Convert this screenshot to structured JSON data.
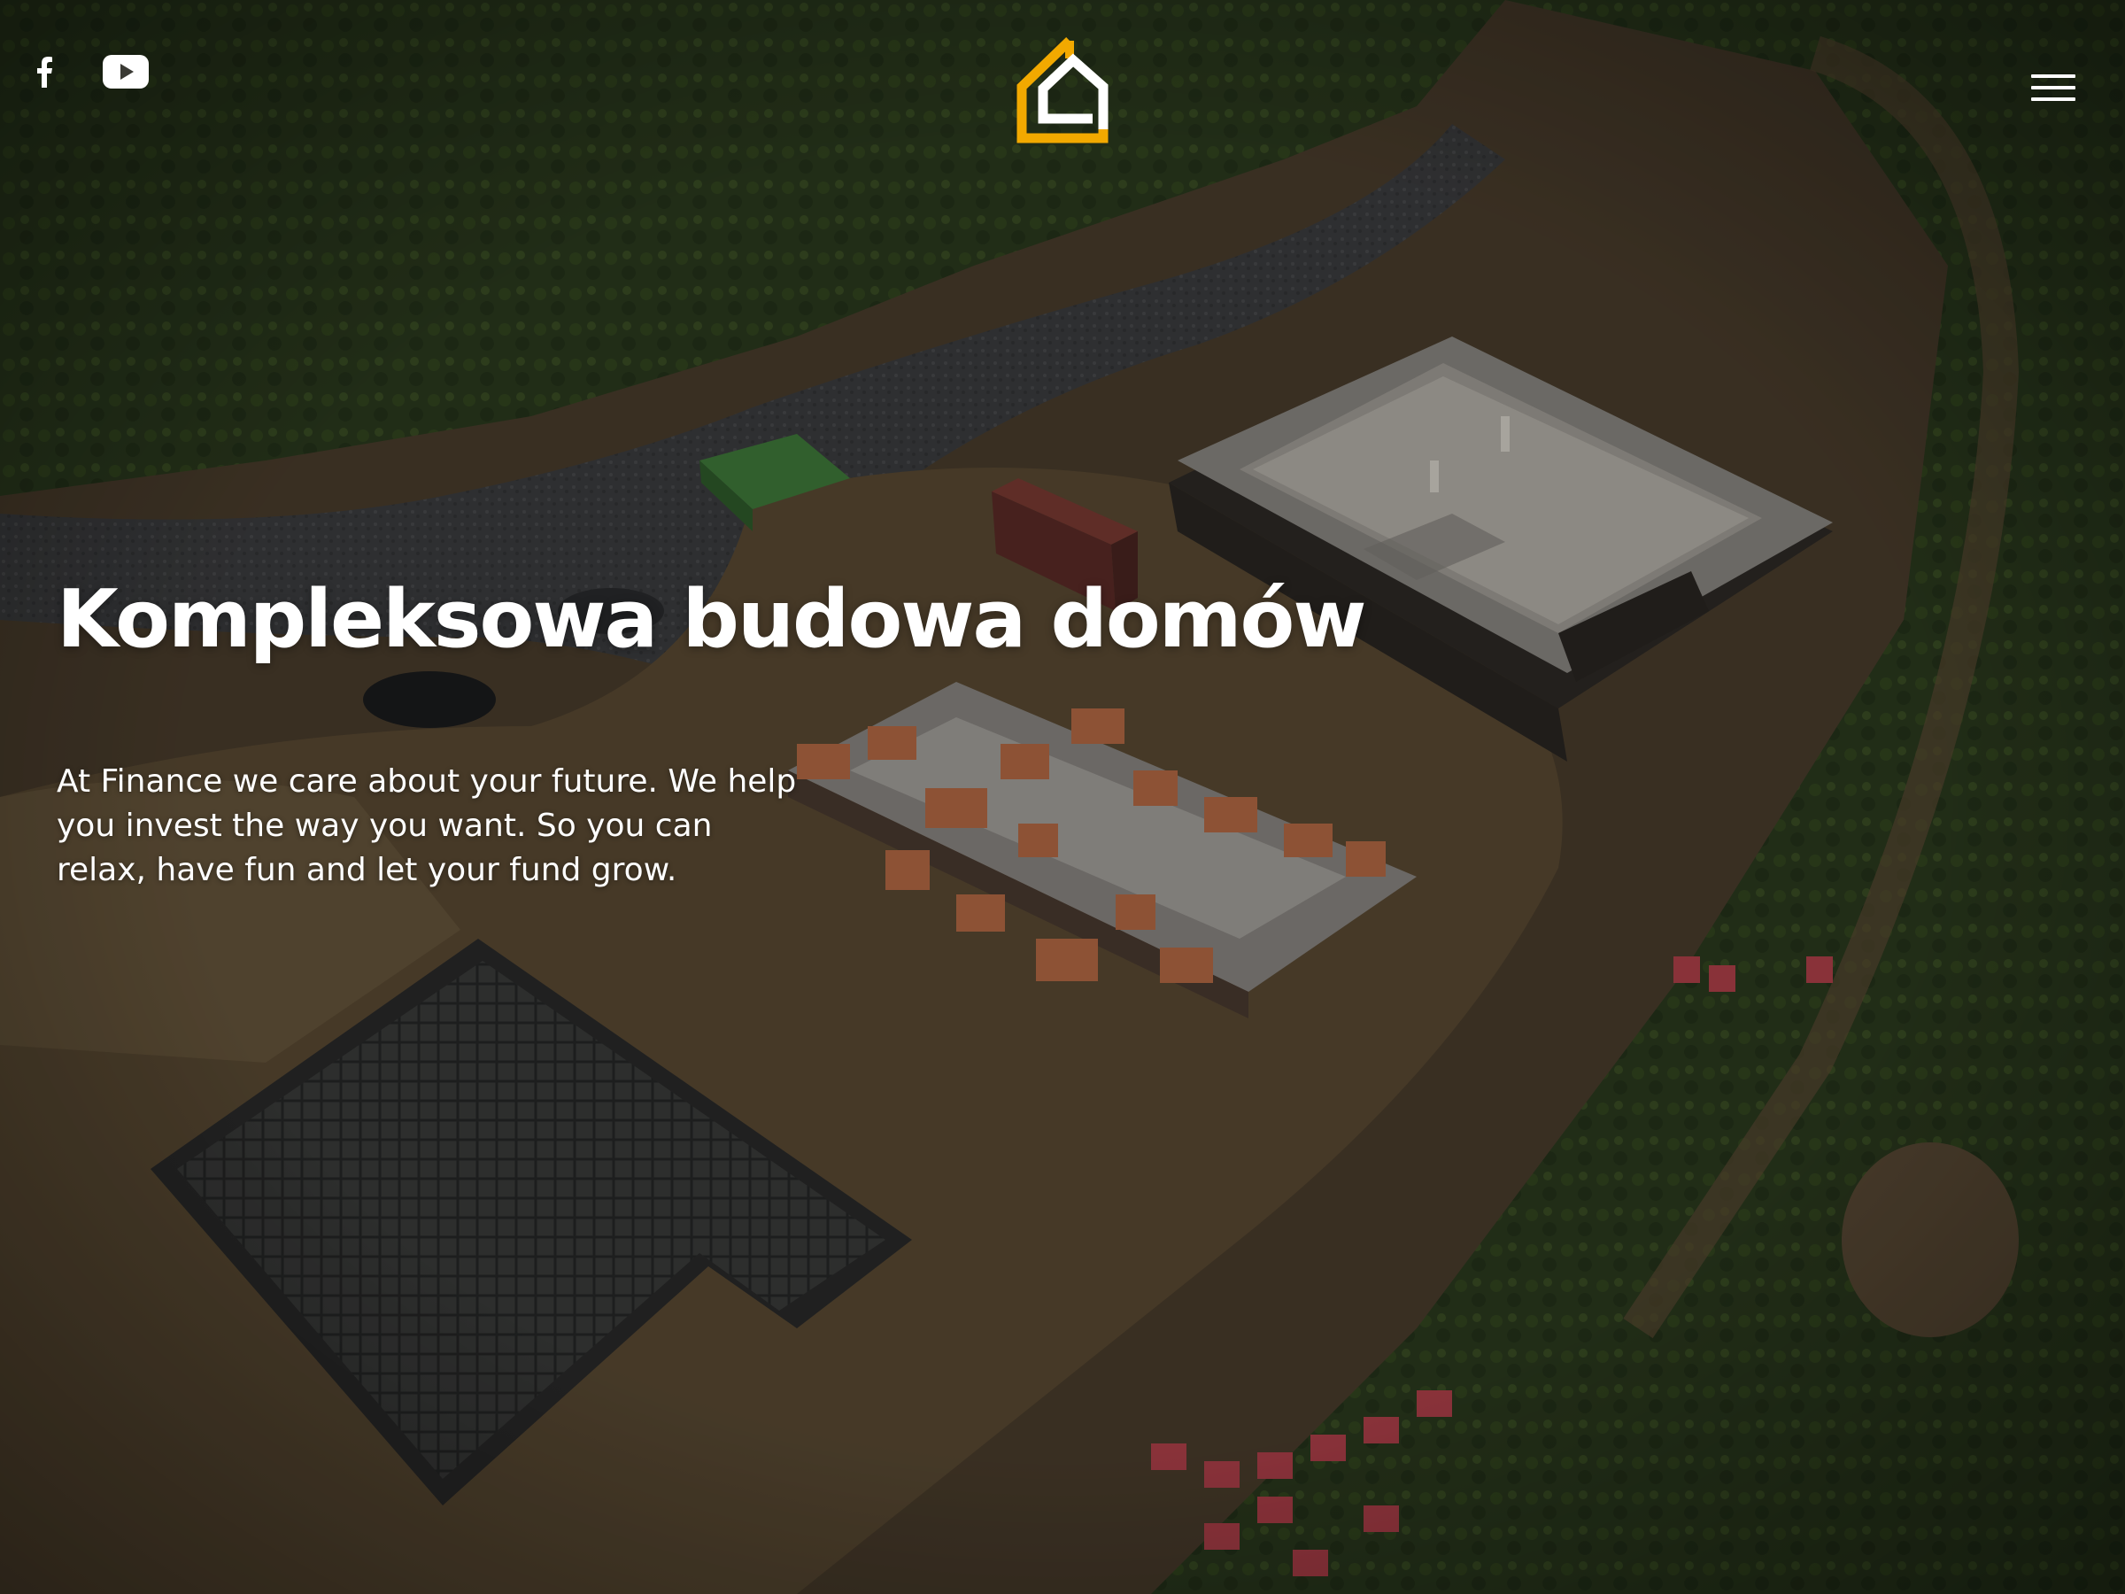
{
  "header": {
    "social": [
      {
        "icon": "facebook-icon",
        "label": "Facebook"
      },
      {
        "icon": "youtube-icon",
        "label": "YouTube"
      }
    ],
    "logo": {
      "icon": "house-logo-icon",
      "color": "#f2a900"
    },
    "menu": {
      "icon": "hamburger-menu-icon"
    }
  },
  "hero": {
    "title": "Kompleksowa budowa domów",
    "description": "At Finance we care about your future. We help you invest the way you want. So you can relax, have fun and let your fund grow.",
    "background": "aerial-construction-site-image"
  },
  "colors": {
    "accent": "#f2a900",
    "text": "#ffffff"
  }
}
